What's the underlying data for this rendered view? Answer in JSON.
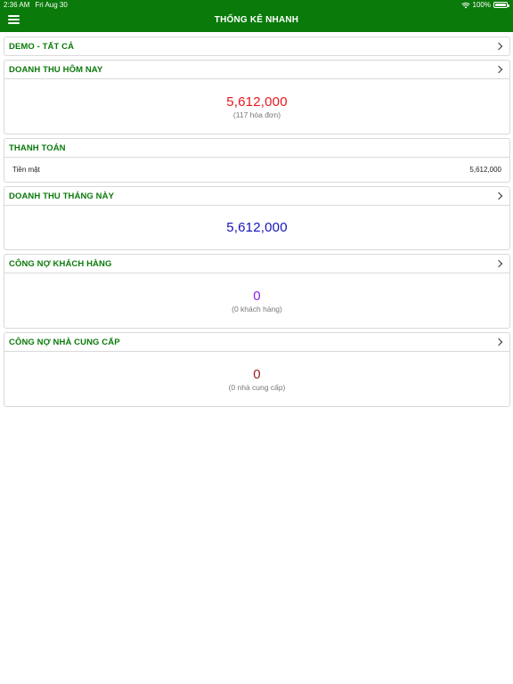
{
  "status_bar": {
    "time": "2:36 AM",
    "date": "Fri Aug 30",
    "battery": "100%"
  },
  "header": {
    "title": "THỐNG KÊ NHANH",
    "menu_icon": "hamburger-menu-icon"
  },
  "colors": {
    "brand_green": "#0a7a0a",
    "revenue_today": "#e8171d",
    "revenue_month": "#1414b8",
    "customer_debt": "#8c1ee6",
    "supplier_debt": "#a01e1e"
  },
  "sections": {
    "store": {
      "title": "DEMO - TẤT CẢ"
    },
    "revenue_today": {
      "title": "DOANH THU HÔM NAY",
      "value": "5,612,000",
      "sub": "(117 hóa đơn)"
    },
    "payment": {
      "title": "THANH TOÁN",
      "rows": [
        {
          "label": "Tiền mặt",
          "value": "5,612,000"
        }
      ]
    },
    "revenue_month": {
      "title": "DOANH THU THÁNG NÀY",
      "value": "5,612,000"
    },
    "customer_debt": {
      "title": "CÔNG NỢ KHÁCH HÀNG",
      "value": "0",
      "sub": "(0 khách hàng)"
    },
    "supplier_debt": {
      "title": "CÔNG NỢ NHÀ CUNG CẤP",
      "value": "0",
      "sub": "(0 nhà cung cấp)"
    }
  }
}
